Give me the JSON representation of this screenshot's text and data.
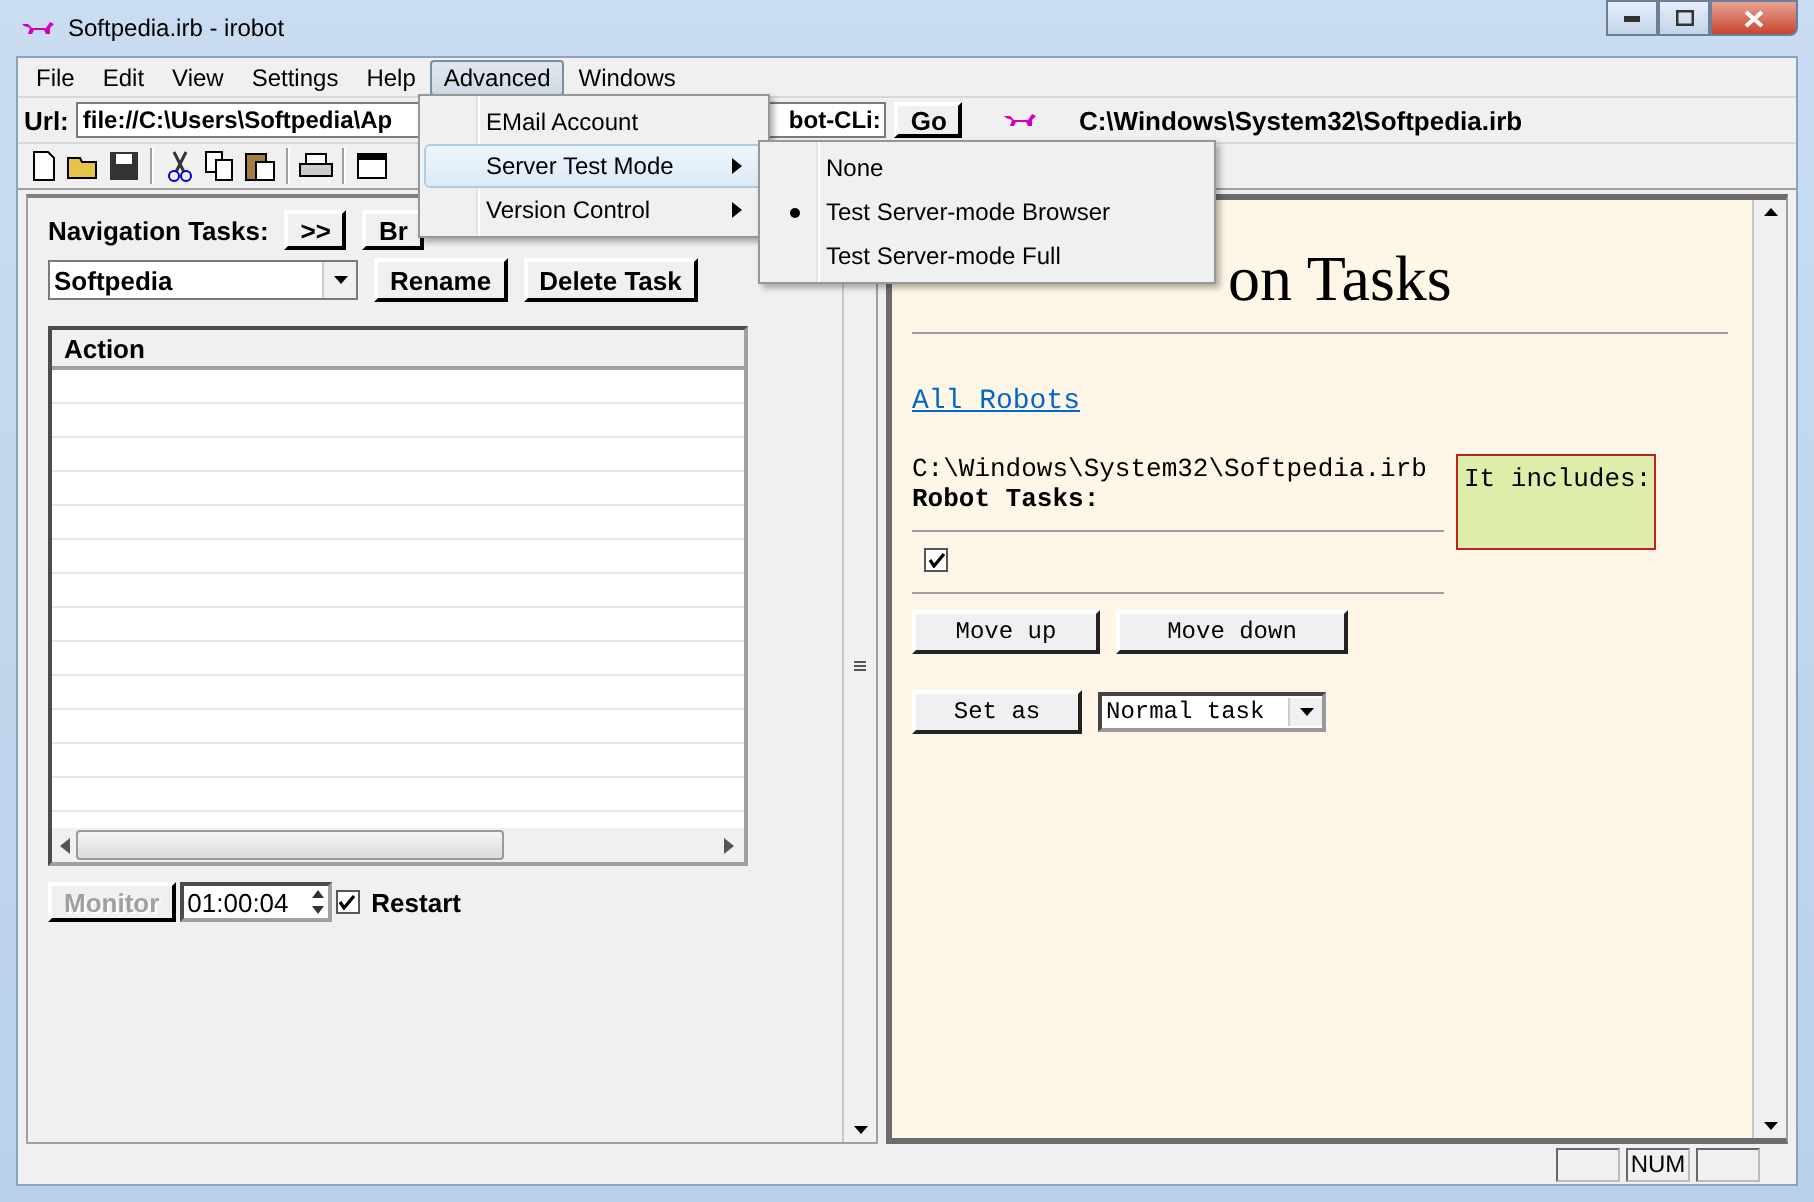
{
  "window": {
    "title": "Softpedia.irb - irobot"
  },
  "menu_bar": [
    {
      "label": "File",
      "selected": false
    },
    {
      "label": "Edit",
      "selected": false
    },
    {
      "label": "View",
      "selected": false
    },
    {
      "label": "Settings",
      "selected": false
    },
    {
      "label": "Help",
      "selected": false
    },
    {
      "label": "Advanced",
      "selected": true
    },
    {
      "label": "Windows",
      "selected": false
    }
  ],
  "url_bar": {
    "label": "Url:",
    "value_start": "file://C:\\Users\\Softpedia\\Ap",
    "value_end": "bot-CLi:",
    "go": "Go",
    "path": "C:\\Windows\\System32\\Softpedia.irb"
  },
  "left_pane": {
    "nav_label": "Navigation Tasks:",
    "expand": ">>",
    "browse": "Br",
    "task_select": "Softpedia",
    "rename": "Rename",
    "delete": "Delete Task",
    "table": {
      "columns": [
        "Action"
      ]
    },
    "monitor": {
      "label": "Monitor",
      "disabled": true
    },
    "interval": "01:00:04",
    "restart": {
      "label": "Restart",
      "checked": true
    }
  },
  "right_pane": {
    "heading": "on Tasks",
    "link": "All Robots",
    "path": "C:\\Windows\\System32\\Softpedia.irb",
    "section": "Robot Tasks:",
    "task_checked": true,
    "includes": "It includes:",
    "move_up": "Move up",
    "move_down": "Move down",
    "set_as": "Set as",
    "task_type": "Normal task"
  },
  "advanced_menu": [
    {
      "label": "EMail Account",
      "submenu": false,
      "highlighted": false
    },
    {
      "label": "Server Test Mode",
      "submenu": true,
      "highlighted": true
    },
    {
      "label": "Version Control",
      "submenu": true,
      "highlighted": false
    }
  ],
  "server_test_mode_menu": [
    {
      "label": "None",
      "selected": false
    },
    {
      "label": "Test Server-mode Browser",
      "selected": true
    },
    {
      "label": "Test Server-mode Full",
      "selected": false
    }
  ],
  "status_bar": {
    "num": "NUM"
  }
}
